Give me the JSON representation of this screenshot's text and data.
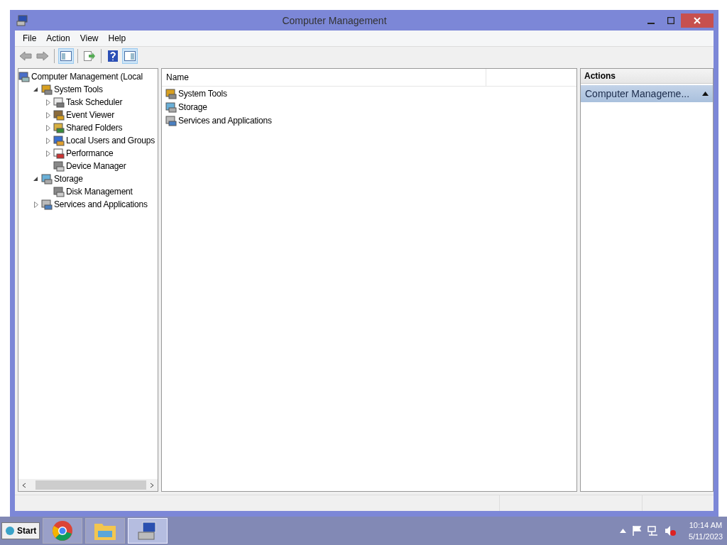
{
  "window": {
    "title": "Computer Management"
  },
  "menu": [
    "File",
    "Action",
    "View",
    "Help"
  ],
  "toolbar": [
    {
      "kind": "back",
      "selected": false
    },
    {
      "kind": "forward",
      "selected": false
    },
    {
      "kind": "tree",
      "selected": true
    },
    {
      "kind": "export",
      "selected": false
    },
    {
      "kind": "help",
      "selected": false
    },
    {
      "kind": "pane",
      "selected": true
    }
  ],
  "tree": {
    "label": "Computer Management (Local",
    "children": [
      {
        "label": "System Tools",
        "expanded": true,
        "children": [
          {
            "label": "Task Scheduler",
            "expanded": false
          },
          {
            "label": "Event Viewer",
            "expanded": false
          },
          {
            "label": "Shared Folders",
            "expanded": false
          },
          {
            "label": "Local Users and Groups",
            "expanded": false
          },
          {
            "label": "Performance",
            "expanded": false
          },
          {
            "label": "Device Manager"
          }
        ]
      },
      {
        "label": "Storage",
        "expanded": true,
        "children": [
          {
            "label": "Disk Management"
          }
        ]
      },
      {
        "label": "Services and Applications",
        "expanded": false
      }
    ]
  },
  "list": {
    "columns": [
      "Name"
    ],
    "rows": [
      "System Tools",
      "Storage",
      "Services and Applications"
    ]
  },
  "actions": {
    "title": "Actions",
    "items": [
      {
        "label": "Computer Manageme...",
        "expanded": true
      }
    ]
  },
  "taskbar": {
    "start": "Start",
    "apps": [
      {
        "kind": "browser",
        "selected": false
      },
      {
        "kind": "folder",
        "selected": false
      },
      {
        "kind": "computer",
        "selected": true
      }
    ],
    "time": "10:14 AM",
    "date": "5/11/2023"
  }
}
